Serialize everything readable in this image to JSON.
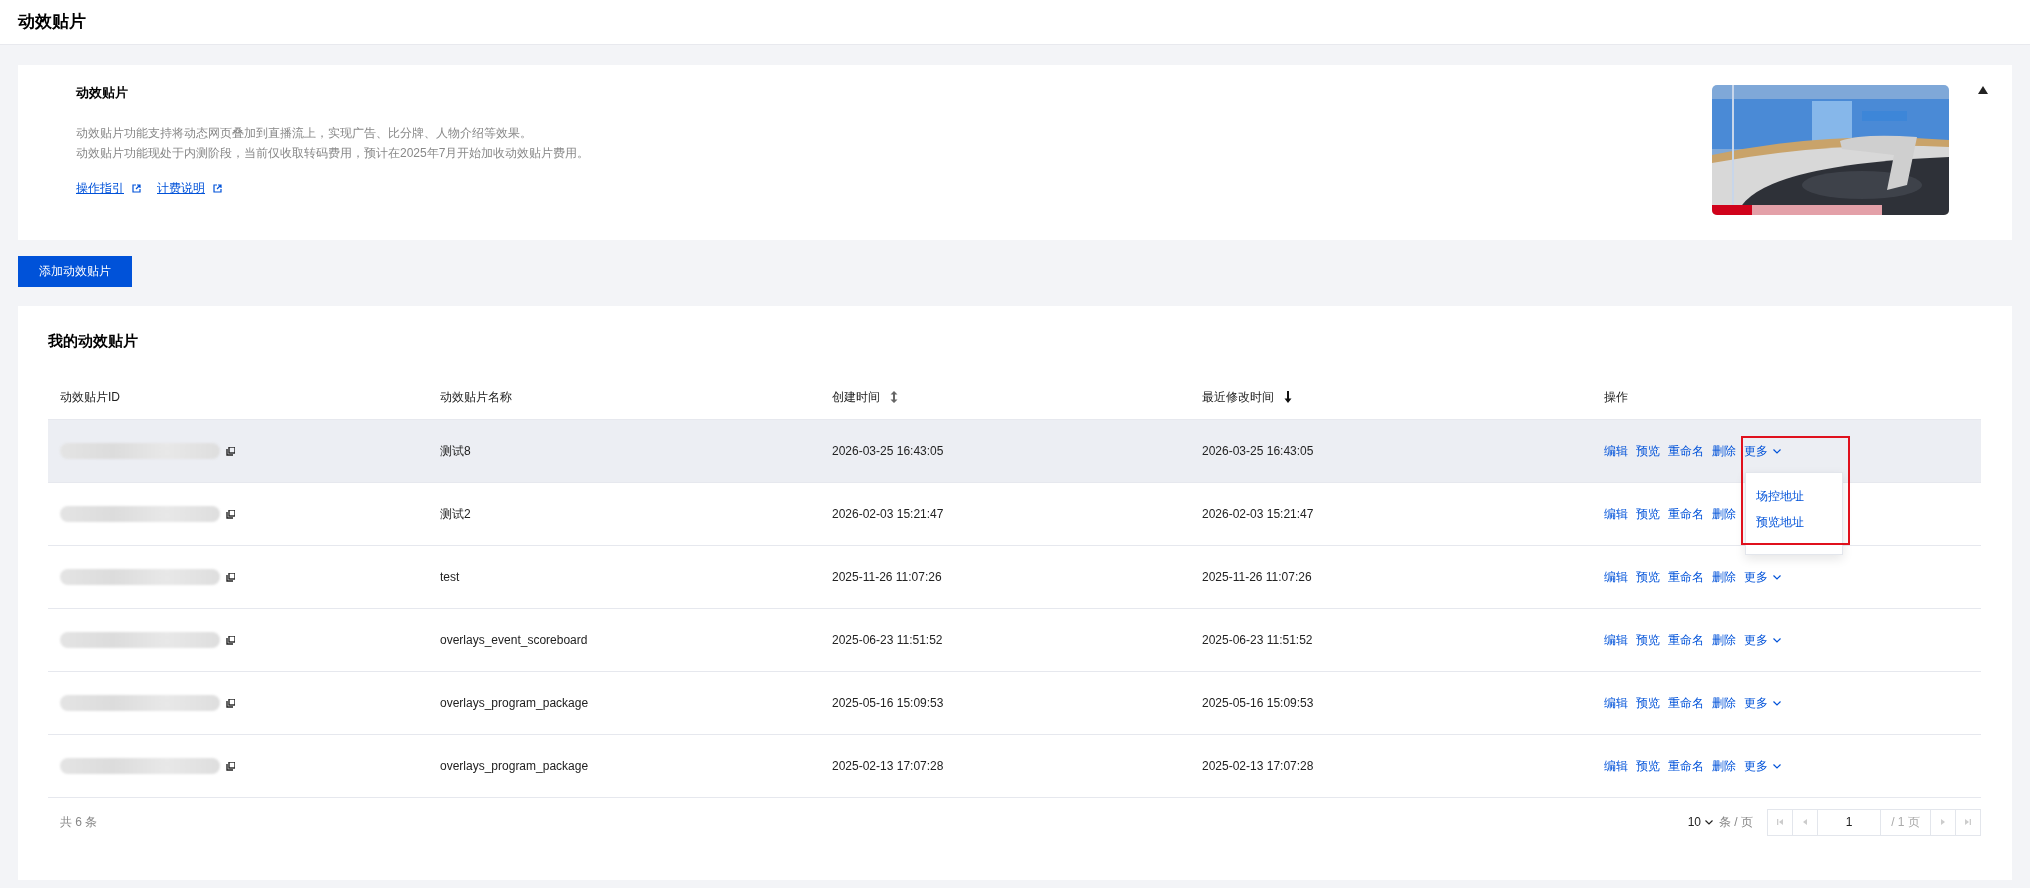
{
  "page": {
    "title": "动效贴片"
  },
  "intro": {
    "title": "动效贴片",
    "lines": [
      "动效贴片功能支持将动态网页叠加到直播流上，实现广告、比分牌、人物介绍等效果。",
      "动效贴片功能现处于内测阶段，当前仅收取转码费用，预计在2025年7月开始加收动效贴片费用。"
    ],
    "links": [
      "操作指引",
      "计费说明"
    ],
    "expanded": true
  },
  "add_button": "添加动效贴片",
  "table": {
    "title": "我的动效贴片",
    "columns": [
      {
        "label": "动效贴片ID",
        "kind": "plain"
      },
      {
        "label": "动效贴片名称",
        "kind": "plain"
      },
      {
        "label": "创建时间",
        "kind": "sortable"
      },
      {
        "label": "最近修改时间",
        "kind": "sorted_desc"
      },
      {
        "label": "操作",
        "kind": "plain"
      }
    ],
    "rows": [
      {
        "name": "测试8",
        "created": "2026-03-25 16:43:05",
        "modified": "2026-03-25 16:43:05",
        "hovered": true,
        "actions": [
          "编辑",
          "预览",
          "重命名",
          "删除"
        ],
        "more": "更多",
        "menu": {
          "items": [
            "场控地址",
            "预览地址"
          ],
          "highlighted": true
        }
      },
      {
        "name": "测试2",
        "created": "2026-02-03 15:21:47",
        "modified": "2026-02-03 15:21:47",
        "actions": [
          "编辑",
          "预览",
          "重命名",
          "删除"
        ]
      },
      {
        "name": "test",
        "created": "2025-11-26 11:07:26",
        "modified": "2025-11-26 11:07:26",
        "actions": [
          "编辑",
          "预览",
          "重命名",
          "删除"
        ],
        "more": "更多"
      },
      {
        "name": "overlays_event_scoreboard",
        "created": "2025-06-23 11:51:52",
        "modified": "2025-06-23 11:51:52",
        "actions": [
          "编辑",
          "预览",
          "重命名",
          "删除"
        ],
        "more": "更多"
      },
      {
        "name": "overlays_program_package",
        "created": "2025-05-16 15:09:53",
        "modified": "2025-05-16 15:09:53",
        "actions": [
          "编辑",
          "预览",
          "重命名",
          "删除"
        ],
        "more": "更多"
      },
      {
        "name": "overlays_program_package",
        "created": "2025-02-13 17:07:28",
        "modified": "2025-02-13 17:07:28",
        "actions": [
          "编辑",
          "预览",
          "重命名",
          "删除"
        ],
        "more": "更多"
      }
    ],
    "total": "共 6 条",
    "pager": {
      "page_size": "10",
      "per_page": "条 / 页",
      "page": "1",
      "pages": "/ 1 页"
    }
  }
}
